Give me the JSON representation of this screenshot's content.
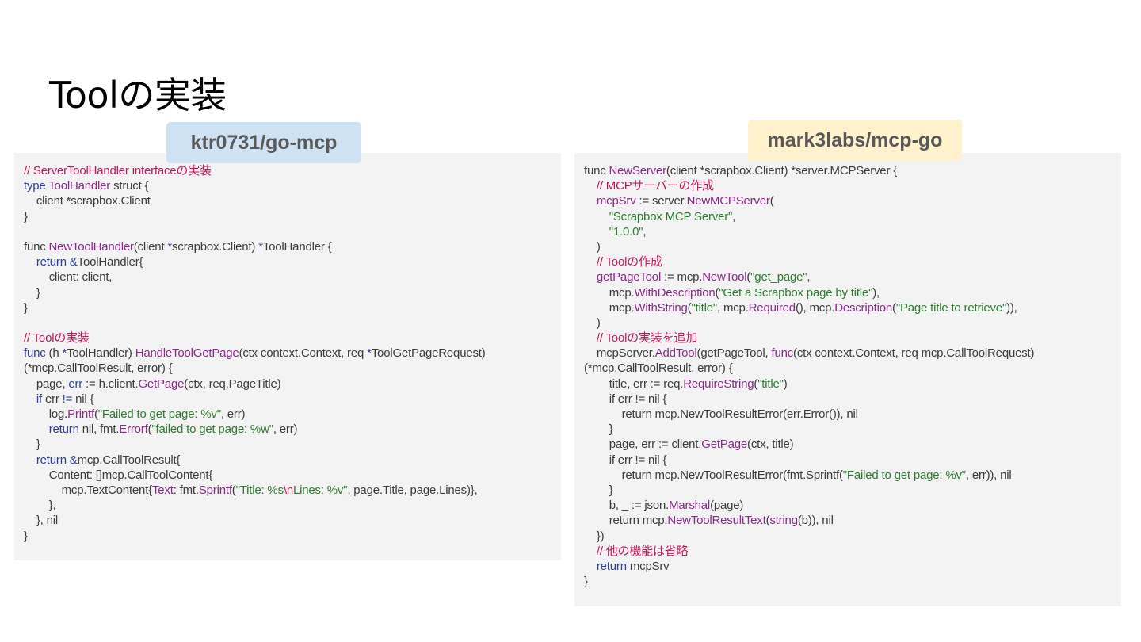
{
  "title": "Toolの実装",
  "left_panel": {
    "badge": "ktr0731/go-mcp",
    "lines": [
      [
        [
          "cm",
          "// ServerToolHandler interfaceの実装"
        ]
      ],
      [
        [
          "kw",
          "type "
        ],
        [
          "type",
          "ToolHandler"
        ],
        [
          "plain",
          " struct {"
        ]
      ],
      [
        [
          "plain",
          "    client *scrapbox.Client"
        ]
      ],
      [
        [
          "plain",
          "}"
        ]
      ],
      [
        [
          "plain",
          ""
        ]
      ],
      [
        [
          "plain",
          "func "
        ],
        [
          "fn",
          "NewToolHandler"
        ],
        [
          "plain",
          "(client "
        ],
        [
          "kw",
          "*"
        ],
        [
          "plain",
          "scrapbox.Client) "
        ],
        [
          "kw",
          "*"
        ],
        [
          "plain",
          "ToolHandler {"
        ]
      ],
      [
        [
          "plain",
          "    "
        ],
        [
          "kw",
          "return &"
        ],
        [
          "plain",
          "ToolHandler{"
        ]
      ],
      [
        [
          "plain",
          "        client: client,"
        ]
      ],
      [
        [
          "plain",
          "    }"
        ]
      ],
      [
        [
          "plain",
          "}"
        ]
      ],
      [
        [
          "plain",
          ""
        ]
      ],
      [
        [
          "cm",
          "// Toolの実装"
        ]
      ],
      [
        [
          "kw",
          "func "
        ],
        [
          "plain",
          "(h "
        ],
        [
          "kw",
          "*"
        ],
        [
          "plain",
          "ToolHandler) "
        ],
        [
          "fn",
          "HandleToolGetPage"
        ],
        [
          "plain",
          "(ctx context.Context, req "
        ],
        [
          "kw",
          "*"
        ],
        [
          "plain",
          "ToolGetPageRequest)"
        ]
      ],
      [
        [
          "plain",
          "(*mcp.CallToolResult, error) {"
        ]
      ],
      [
        [
          "plain",
          "    page, "
        ],
        [
          "kw",
          "err"
        ],
        [
          "plain",
          " := h.client."
        ],
        [
          "fn",
          "GetPage"
        ],
        [
          "plain",
          "(ctx, req.PageTitle)"
        ]
      ],
      [
        [
          "plain",
          "    "
        ],
        [
          "kw",
          "if "
        ],
        [
          "plain",
          "err "
        ],
        [
          "kw",
          "!="
        ],
        [
          "plain",
          " nil {"
        ]
      ],
      [
        [
          "plain",
          "        log."
        ],
        [
          "fn",
          "Printf"
        ],
        [
          "plain",
          "("
        ],
        [
          "str",
          "\"Failed to get page: %v\""
        ],
        [
          "plain",
          ", err)"
        ]
      ],
      [
        [
          "plain",
          "        "
        ],
        [
          "kw",
          "return"
        ],
        [
          "plain",
          " nil, fmt."
        ],
        [
          "fn",
          "Errorf"
        ],
        [
          "plain",
          "("
        ],
        [
          "str",
          "\"failed to get page: %w\""
        ],
        [
          "plain",
          ", err)"
        ]
      ],
      [
        [
          "plain",
          "    }"
        ]
      ],
      [
        [
          "plain",
          "    "
        ],
        [
          "kw",
          "return &"
        ],
        [
          "plain",
          "mcp.CallToolResult{"
        ]
      ],
      [
        [
          "plain",
          "        Content: []mcp.CallToolContent{"
        ]
      ],
      [
        [
          "plain",
          "            mcp.TextContent{"
        ],
        [
          "fn",
          "Text"
        ],
        [
          "plain",
          ": fmt."
        ],
        [
          "fn",
          "Sprintf"
        ],
        [
          "plain",
          "("
        ],
        [
          "str",
          "\"Title: %s"
        ],
        [
          "cm",
          "\\n"
        ],
        [
          "str",
          "Lines: %v\""
        ],
        [
          "plain",
          ", page.Title, page.Lines)},"
        ]
      ],
      [
        [
          "plain",
          "        },"
        ]
      ],
      [
        [
          "plain",
          "    }, nil"
        ]
      ],
      [
        [
          "plain",
          "}"
        ]
      ]
    ]
  },
  "right_panel": {
    "badge": "mark3labs/mcp-go",
    "lines": [
      [
        [
          "plain",
          "func "
        ],
        [
          "fn",
          "NewServer"
        ],
        [
          "plain",
          "(client *scrapbox.Client) *server.MCPServer {"
        ]
      ],
      [
        [
          "plain",
          "    "
        ],
        [
          "cm",
          "// MCPサーバーの作成"
        ]
      ],
      [
        [
          "plain",
          "    "
        ],
        [
          "fn",
          "mcpSrv"
        ],
        [
          "plain",
          " := server."
        ],
        [
          "fn",
          "NewMCPServer"
        ],
        [
          "plain",
          "("
        ]
      ],
      [
        [
          "plain",
          "        "
        ],
        [
          "str",
          "\"Scrapbox MCP Server\""
        ],
        [
          "plain",
          ","
        ]
      ],
      [
        [
          "plain",
          "        "
        ],
        [
          "str",
          "\"1.0.0\""
        ],
        [
          "plain",
          ","
        ]
      ],
      [
        [
          "plain",
          "    )"
        ]
      ],
      [
        [
          "plain",
          "    "
        ],
        [
          "cm",
          "// Toolの作成"
        ]
      ],
      [
        [
          "plain",
          "    "
        ],
        [
          "fn",
          "getPageTool"
        ],
        [
          "plain",
          " := mcp."
        ],
        [
          "fn",
          "NewTool"
        ],
        [
          "plain",
          "("
        ],
        [
          "str",
          "\"get_page\""
        ],
        [
          "plain",
          ","
        ]
      ],
      [
        [
          "plain",
          "        mcp."
        ],
        [
          "fn",
          "WithDescription"
        ],
        [
          "plain",
          "("
        ],
        [
          "str",
          "\"Get a Scrapbox page by title\""
        ],
        [
          "plain",
          "),"
        ]
      ],
      [
        [
          "plain",
          "        mcp."
        ],
        [
          "fn",
          "WithString"
        ],
        [
          "plain",
          "("
        ],
        [
          "str",
          "\"title\""
        ],
        [
          "plain",
          ", mcp."
        ],
        [
          "fn",
          "Required"
        ],
        [
          "plain",
          "(), mcp."
        ],
        [
          "fn",
          "Description"
        ],
        [
          "plain",
          "("
        ],
        [
          "str",
          "\"Page title to retrieve\""
        ],
        [
          "plain",
          ")),"
        ]
      ],
      [
        [
          "plain",
          "    )"
        ]
      ],
      [
        [
          "plain",
          "    "
        ],
        [
          "cm",
          "// Toolの実装を追加"
        ]
      ],
      [
        [
          "plain",
          "    mcpServer."
        ],
        [
          "fn",
          "AddTool"
        ],
        [
          "plain",
          "(getPageTool, "
        ],
        [
          "fn",
          "func"
        ],
        [
          "plain",
          "(ctx context.Context, req mcp.CallToolRequest)"
        ]
      ],
      [
        [
          "plain",
          "(*mcp.CallToolResult, error) {"
        ]
      ],
      [
        [
          "plain",
          "        title, err := req."
        ],
        [
          "fn",
          "RequireString"
        ],
        [
          "plain",
          "("
        ],
        [
          "str",
          "\"title\""
        ],
        [
          "plain",
          ")"
        ]
      ],
      [
        [
          "plain",
          "        if err != nil {"
        ]
      ],
      [
        [
          "plain",
          "            return mcp.NewToolResultError(err.Error()), nil"
        ]
      ],
      [
        [
          "plain",
          "        }"
        ]
      ],
      [
        [
          "plain",
          "        page, err := client."
        ],
        [
          "fn",
          "GetPage"
        ],
        [
          "plain",
          "(ctx, title)"
        ]
      ],
      [
        [
          "plain",
          "        if err != nil {"
        ]
      ],
      [
        [
          "plain",
          "            return mcp.NewToolResultError(fmt.Sprintf("
        ],
        [
          "str",
          "\"Failed to get page: %v\""
        ],
        [
          "plain",
          ", err)), nil"
        ]
      ],
      [
        [
          "plain",
          "        }"
        ]
      ],
      [
        [
          "plain",
          "        b, _ := json."
        ],
        [
          "fn",
          "Marshal"
        ],
        [
          "plain",
          "(page)"
        ]
      ],
      [
        [
          "plain",
          "        return mcp."
        ],
        [
          "fn",
          "NewToolResultText"
        ],
        [
          "plain",
          "("
        ],
        [
          "fn",
          "string"
        ],
        [
          "plain",
          "(b)), nil"
        ]
      ],
      [
        [
          "plain",
          "    })"
        ]
      ],
      [
        [
          "plain",
          "    "
        ],
        [
          "cm",
          "// 他の機能は省略"
        ]
      ],
      [
        [
          "plain",
          "    "
        ],
        [
          "kw",
          "return"
        ],
        [
          "plain",
          " mcpSrv"
        ]
      ],
      [
        [
          "plain",
          "}"
        ]
      ]
    ]
  }
}
